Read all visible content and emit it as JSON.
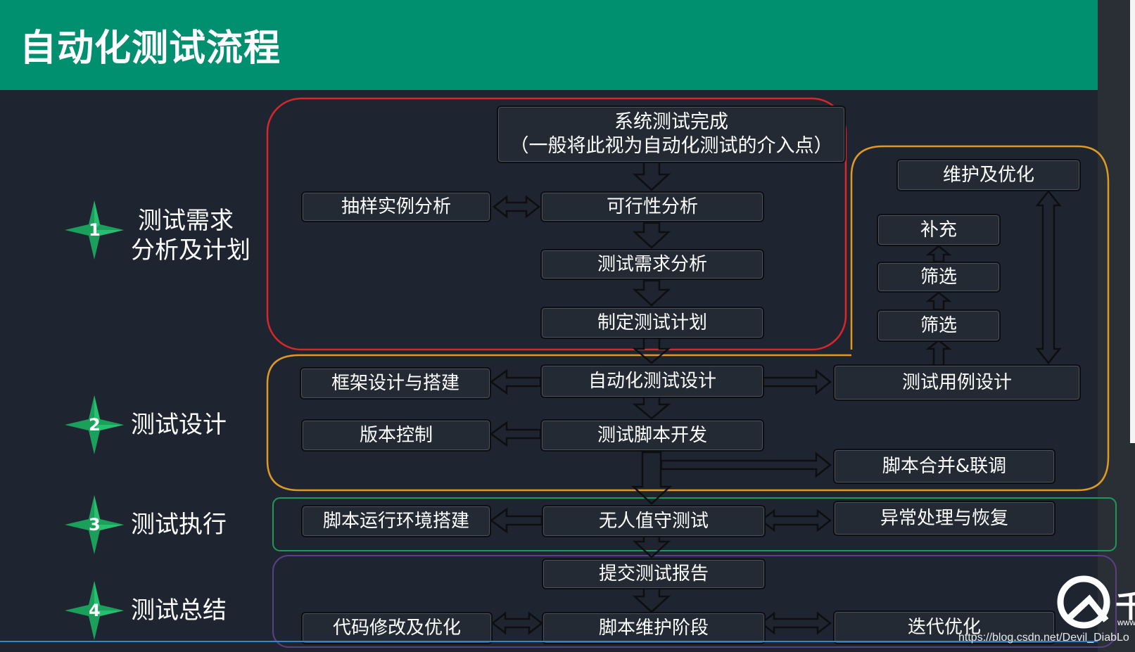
{
  "title": "自动化测试流程",
  "colors": {
    "header": "#008f6f",
    "background": "#1e2530",
    "group_red": "#d8262a",
    "group_orange": "#e09a22",
    "group_green": "#1e9a52",
    "group_purple": "#5a3f86",
    "star_green": "#1aa05a"
  },
  "stages": [
    {
      "num": "1",
      "line1": "测试需求",
      "line2": "分析及计划"
    },
    {
      "num": "2",
      "label": "测试设计"
    },
    {
      "num": "3",
      "label": "测试执行"
    },
    {
      "num": "4",
      "label": "测试总结"
    }
  ],
  "nodes": {
    "system_test_done": "系统测试完成",
    "system_test_done_note": "（一般将此视为自动化测试的介入点）",
    "sample_analysis": "抽样实例分析",
    "feasibility": "可行性分析",
    "requirement_analysis": "测试需求分析",
    "test_plan": "制定测试计划",
    "framework": "框架设计与搭建",
    "auto_design": "自动化测试设计",
    "testcase_design": "测试用例设计",
    "version_control": "版本控制",
    "script_dev": "测试脚本开发",
    "script_merge": "脚本合并&联调",
    "maintain_optimize": "维护及优化",
    "supplement": "补充",
    "filter_1": "筛选",
    "filter_2": "筛选",
    "env_setup": "脚本运行环境搭建",
    "unattended": "无人值守测试",
    "exception": "异常处理与恢复",
    "report": "提交测试报告",
    "code_fix": "代码修改及优化",
    "maintenance_phase": "脚本维护阶段",
    "iteration": "迭代优化"
  },
  "logo": {
    "char": "千",
    "small": "www"
  },
  "watermark": "https://blog.csdn.net/Devil_DiabLo"
}
